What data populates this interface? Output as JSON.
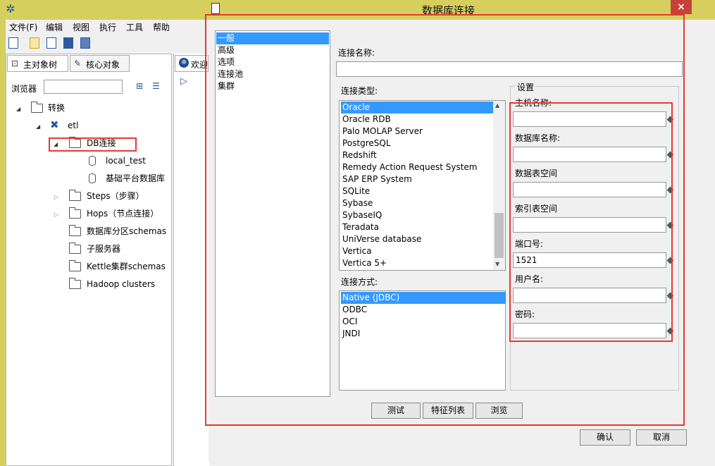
{
  "app": {
    "menus": [
      "文件(F)",
      "编辑",
      "视图",
      "执行",
      "工具",
      "帮助"
    ],
    "tabs": [
      "主对象树",
      "核心对象"
    ],
    "browser_label": "浏览器",
    "welcome_tab": "欢迎",
    "tree": [
      {
        "label": "转换",
        "icon": "folder-icon"
      },
      {
        "label": "etl",
        "icon": "transformation-icon"
      },
      {
        "label": "DB连接",
        "icon": "folder-icon"
      },
      {
        "label": "local_test",
        "icon": "database-icon"
      },
      {
        "label": "基础平台数据库",
        "icon": "database-icon"
      },
      {
        "label": "Steps（步骤）",
        "icon": "folder-icon"
      },
      {
        "label": "Hops（节点连接）",
        "icon": "folder-icon"
      },
      {
        "label": "数据库分区schemas",
        "icon": "folder-icon"
      },
      {
        "label": "子服务器",
        "icon": "folder-icon"
      },
      {
        "label": "Kettle集群schemas",
        "icon": "folder-icon"
      },
      {
        "label": "Hadoop clusters",
        "icon": "folder-icon"
      }
    ]
  },
  "dialog": {
    "title": "数据库连接",
    "close_label": "×",
    "nav": [
      "一般",
      "高级",
      "选项",
      "连接池",
      "集群"
    ],
    "conn_name_label": "连接名称:",
    "conn_name_value": "",
    "conn_type_label": "连接类型:",
    "conn_types": [
      "Oracle",
      "Oracle RDB",
      "Palo MOLAP Server",
      "PostgreSQL",
      "Redshift",
      "Remedy Action Request System",
      "SAP ERP System",
      "SQLite",
      "Sybase",
      "SybaseIQ",
      "Teradata",
      "UniVerse database",
      "Vertica",
      "Vertica 5+"
    ],
    "conn_type_selected": "Oracle",
    "access_label": "连接方式:",
    "access_types": [
      "Native (JDBC)",
      "ODBC",
      "OCI",
      "JNDI"
    ],
    "access_selected": "Native (JDBC)",
    "settings_title": "设置",
    "fields": [
      {
        "label": "主机名称:",
        "value": ""
      },
      {
        "label": "数据库名称:",
        "value": ""
      },
      {
        "label": "数据表空间",
        "value": ""
      },
      {
        "label": "索引表空间",
        "value": ""
      },
      {
        "label": "端口号:",
        "value": "1521"
      },
      {
        "label": "用户名:",
        "value": ""
      },
      {
        "label": "密码:",
        "value": ""
      }
    ],
    "buttons": {
      "test": "测试",
      "features": "特征列表",
      "browse": "浏览",
      "ok": "确认",
      "cancel": "取消"
    },
    "highlight_color": "#e53935",
    "selection_color": "#3399ff"
  }
}
